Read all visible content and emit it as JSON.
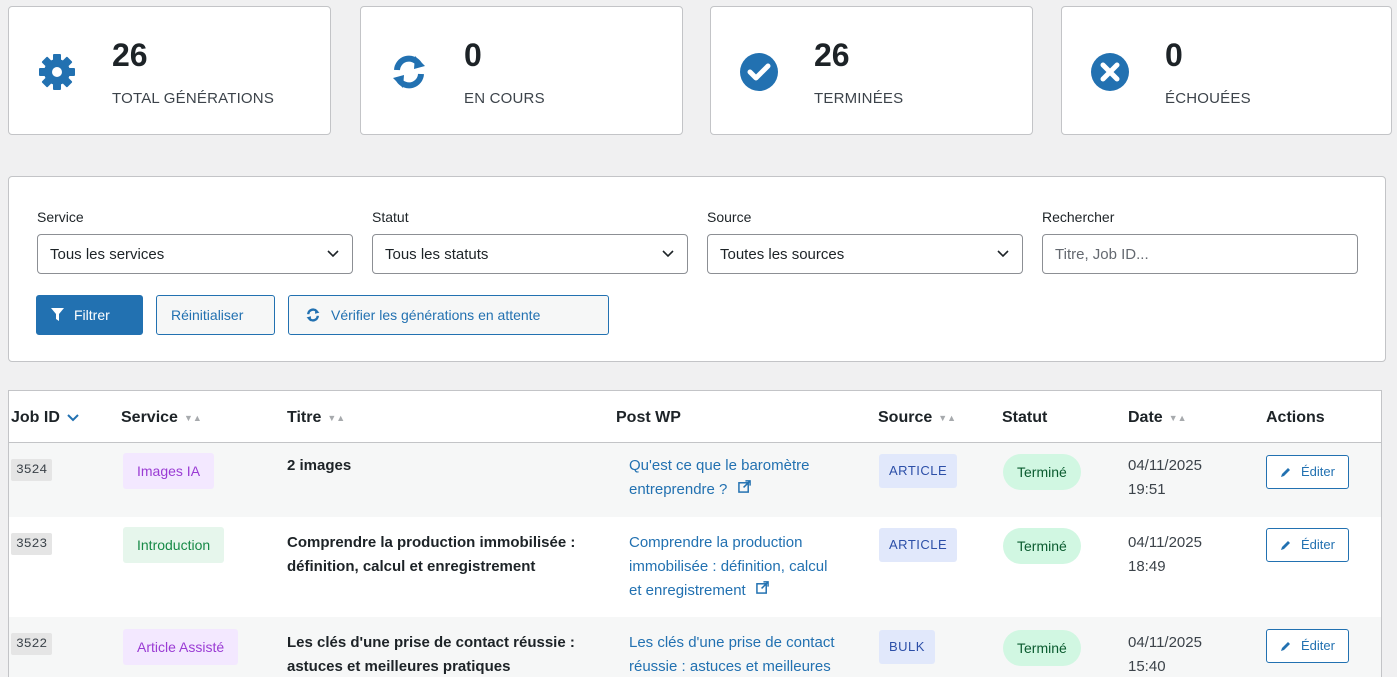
{
  "stats": [
    {
      "value": "26",
      "label": "TOTAL GÉNÉRATIONS",
      "icon": "gear-icon",
      "color": "#2271b1"
    },
    {
      "value": "0",
      "label": "EN COURS",
      "icon": "refresh-icon",
      "color": "#2271b1"
    },
    {
      "value": "26",
      "label": "TERMINÉES",
      "icon": "check-circle-icon",
      "color": "#2271b1"
    },
    {
      "value": "0",
      "label": "ÉCHOUÉES",
      "icon": "x-circle-icon",
      "color": "#2271b1"
    }
  ],
  "filters": {
    "service": {
      "label": "Service",
      "value": "Tous les services"
    },
    "statut": {
      "label": "Statut",
      "value": "Tous les statuts"
    },
    "source": {
      "label": "Source",
      "value": "Toutes les sources"
    },
    "search": {
      "label": "Rechercher",
      "placeholder": "Titre, Job ID..."
    },
    "filter_button": "Filtrer",
    "reset_button": "Réinitialiser",
    "check_button": "Vérifier les générations en attente"
  },
  "table": {
    "columns": [
      "Job ID",
      "Service",
      "Titre",
      "Post WP",
      "Source",
      "Statut",
      "Date",
      "Actions"
    ],
    "rows": [
      {
        "job_id": "3524",
        "service": "Images IA",
        "title_l1": "2 images",
        "title_l2": "",
        "post_l1": "Qu'est ce que le baromètre",
        "post_l2": "entreprendre ?",
        "post_l3": "",
        "source": "ARTICLE",
        "status": "Terminé",
        "date": "04/11/2025",
        "time": "19:51",
        "action": "Éditer"
      },
      {
        "job_id": "3523",
        "service": "Introduction",
        "title_l1": "Comprendre la production immobilisée :",
        "title_l2": "définition, calcul et enregistrement",
        "post_l1": "Comprendre la production",
        "post_l2": "immobilisée : définition, calcul",
        "post_l3": "et enregistrement",
        "source": "ARTICLE",
        "status": "Terminé",
        "date": "04/11/2025",
        "time": "18:49",
        "action": "Éditer"
      },
      {
        "job_id": "3522",
        "service": "Article Assisté",
        "title_l1": "Les clés d'une prise de contact réussie :",
        "title_l2": "astuces et meilleures pratiques",
        "post_l1": "Les clés d'une prise de contact",
        "post_l2": "réussie : astuces et meilleures",
        "post_l3": "",
        "source": "BULK",
        "status": "Terminé",
        "date": "04/11/2025",
        "time": "15:40",
        "action": "Éditer"
      }
    ]
  },
  "colors": {
    "accent": "#2271b1",
    "service_images": "#f3e8ff",
    "service_intro": "#e6f6ec",
    "service_article": "#f3e8ff",
    "status_done": "#d1f7e2"
  }
}
